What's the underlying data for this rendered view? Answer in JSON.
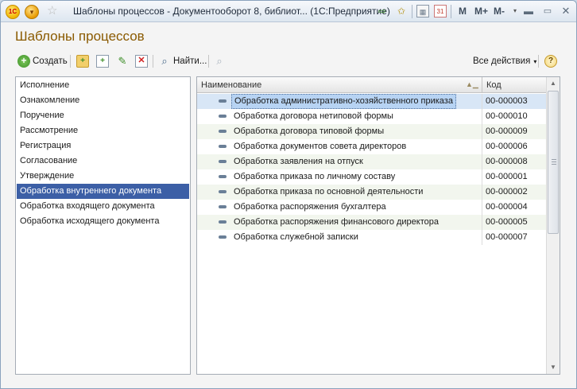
{
  "titlebar": {
    "logo": "1С",
    "title": "Шаблоны процессов - Документооборот 8, библиот... (1С:Предприятие)",
    "m": "M",
    "m_plus": "M+",
    "m_minus": "M-"
  },
  "form": {
    "title": "Шаблоны процессов"
  },
  "toolbar": {
    "create_label": "Создать",
    "find_label": "Найти...",
    "all_actions_label": "Все действия",
    "help_label": "?"
  },
  "left_list": {
    "items": [
      "Исполнение",
      "Ознакомление",
      "Поручение",
      "Рассмотрение",
      "Регистрация",
      "Согласование",
      "Утверждение",
      "Обработка внутреннего документа",
      "Обработка входящего документа",
      "Обработка исходящего документа"
    ],
    "selected_index": 7
  },
  "table": {
    "columns": [
      "Наименование",
      "Код"
    ],
    "selected_index": 0,
    "rows": [
      {
        "name": "Обработка административно-хозяйственного приказа",
        "code": "00-000003"
      },
      {
        "name": "Обработка договора нетиповой формы",
        "code": "00-000010"
      },
      {
        "name": "Обработка договора типовой формы",
        "code": "00-000009"
      },
      {
        "name": "Обработка документов совета директоров",
        "code": "00-000006"
      },
      {
        "name": "Обработка заявления на отпуск",
        "code": "00-000008"
      },
      {
        "name": "Обработка приказа по личному составу",
        "code": "00-000001"
      },
      {
        "name": "Обработка приказа по основной деятельности",
        "code": "00-000002"
      },
      {
        "name": "Обработка распоряжения бухгалтера",
        "code": "00-000004"
      },
      {
        "name": "Обработка распоряжения финансового директора",
        "code": "00-000005"
      },
      {
        "name": "Обработка служебной записки",
        "code": "00-000007"
      }
    ]
  },
  "colors": {
    "title_color": "#8a5a00",
    "selection": "#3c5fa6",
    "row_alt": "#f2f6ee"
  }
}
